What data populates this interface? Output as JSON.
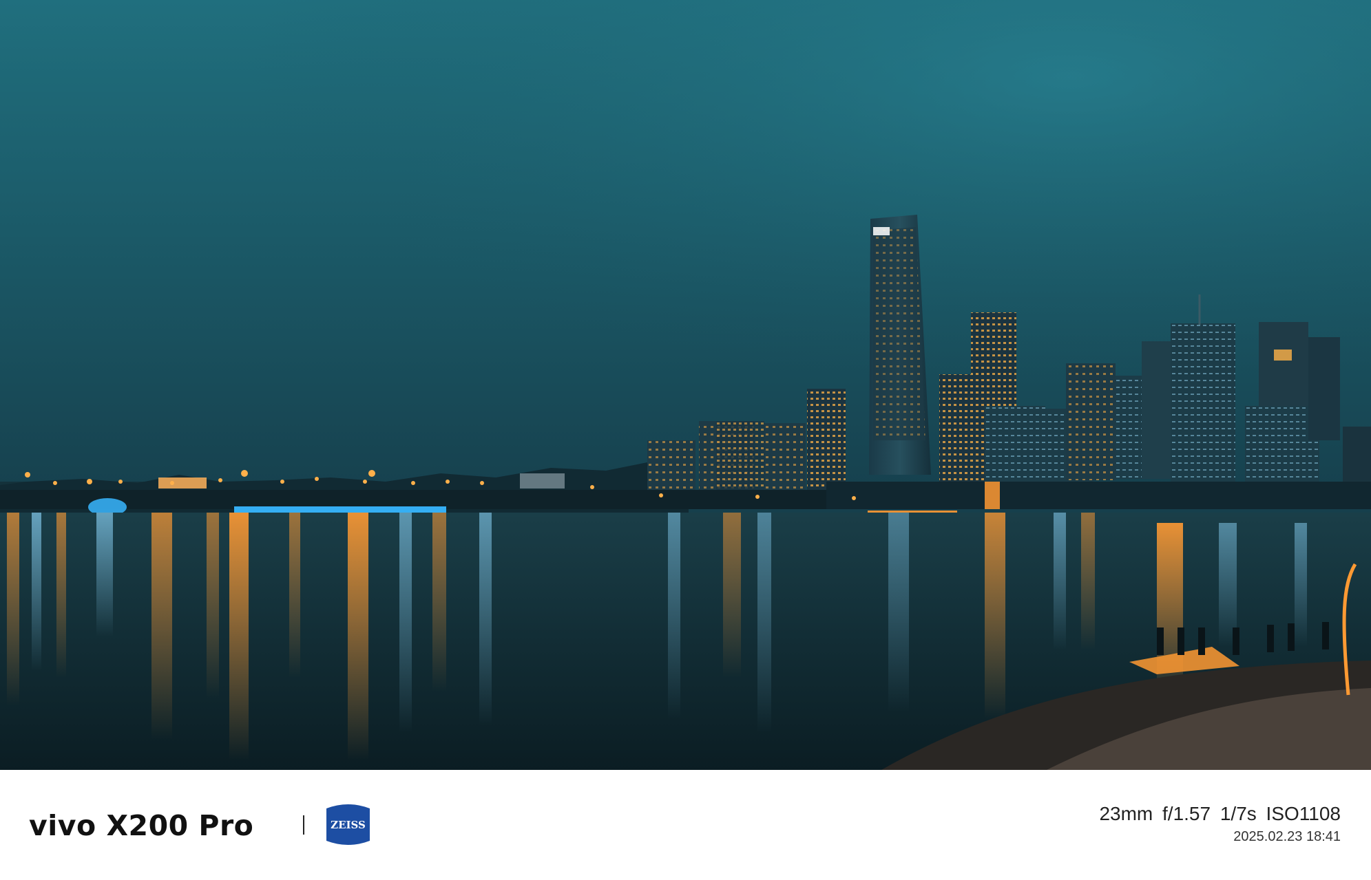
{
  "photo": {
    "subject": "night-city-skyline-over-lake",
    "colors": {
      "sky_top": "#1f6f7d",
      "sky_bottom": "#164653",
      "water": "#0f2a33",
      "city_light_orange": "#ff9a33",
      "city_light_blue": "#38b6ff"
    }
  },
  "watermark": {
    "brand": "vivo X200 Pro",
    "logo_text": "ZEISS",
    "logo_color": "#1d4ea3",
    "exif_params": "23mm f/1.57 1/7s ISO1108",
    "exif_datetime": "2025.02.23 18:41"
  }
}
